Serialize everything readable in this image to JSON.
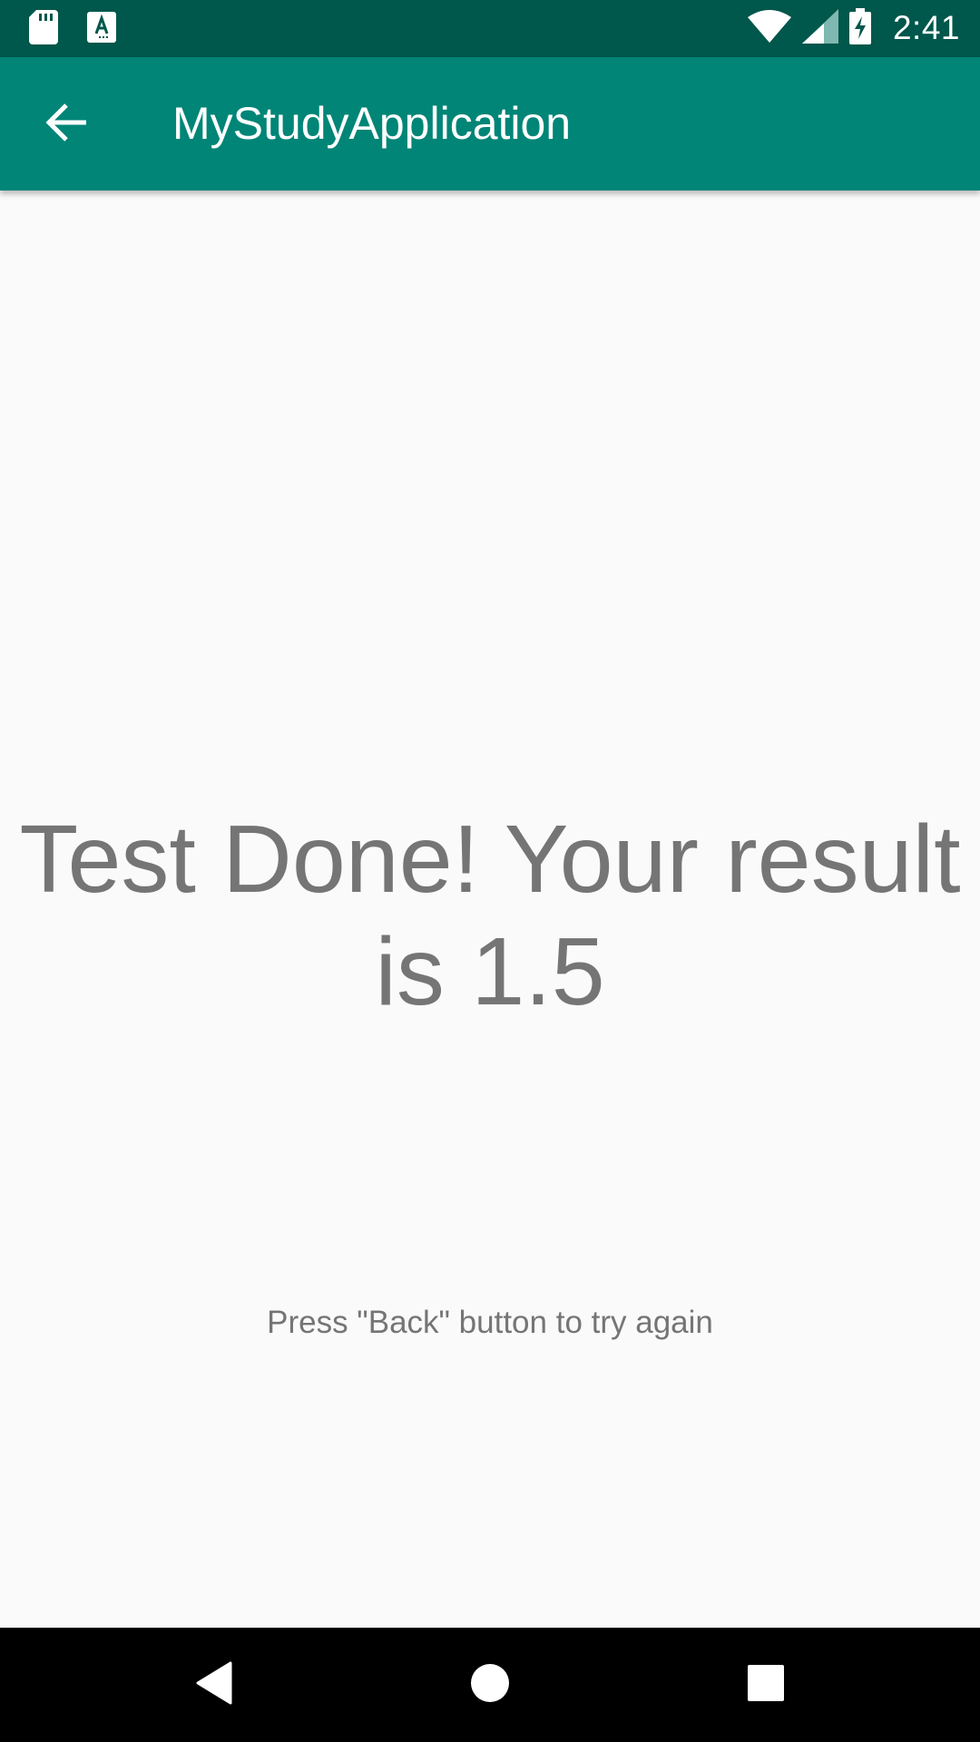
{
  "status_bar": {
    "time": "2:41",
    "icons": [
      "sd-card-icon",
      "keyboard-a-icon",
      "wifi-icon",
      "cell-signal-icon",
      "battery-charging-icon"
    ]
  },
  "app_bar": {
    "title": "MyStudyApplication",
    "back_icon": "arrow-back-icon"
  },
  "main": {
    "result": "Test Done! Your result is 1.5",
    "hint": "Press \"Back\" button to try again"
  },
  "nav_bar": {
    "icons": [
      "nav-back-icon",
      "nav-home-icon",
      "nav-recents-icon"
    ]
  },
  "colors": {
    "status_bar": "#00574b",
    "app_bar": "#008577",
    "background": "#fafafa",
    "text_secondary": "#757575"
  }
}
